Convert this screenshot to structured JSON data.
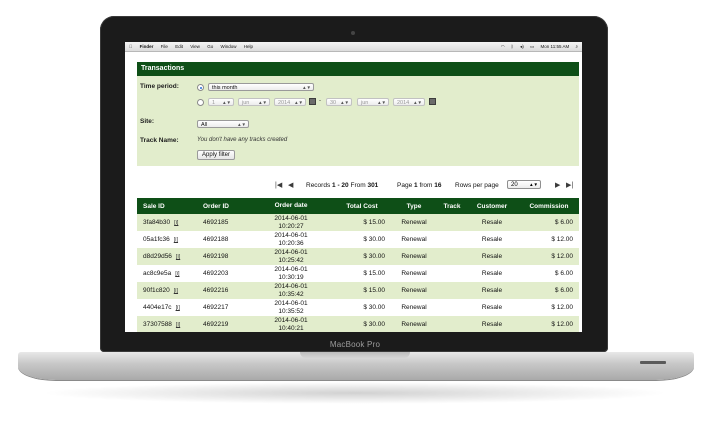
{
  "device": {
    "label": "MacBook Pro"
  },
  "menubar": {
    "items": [
      "Finder",
      "File",
      "Edit",
      "View",
      "Go",
      "Window",
      "Help"
    ],
    "clock": "Mon 11:55 AM"
  },
  "panel": {
    "title": "Transactions",
    "time_period_label": "Time period:",
    "period_value": "this month",
    "from_day": "1",
    "from_month": "jun",
    "from_year": "2014",
    "to_day": "30",
    "to_month": "jun",
    "to_year": "2014",
    "site_label": "Site:",
    "site_value": "All",
    "track_label": "Track Name:",
    "track_note": "You don't have any tracks created",
    "apply_label": "Apply filter"
  },
  "pager": {
    "records_label": "Records",
    "range": "1 - 20",
    "from_label": "From",
    "total": "301",
    "page_label": "Page",
    "page": "1",
    "page_from_label": "from",
    "pages": "16",
    "rows_label": "Rows per page",
    "rows_value": "20"
  },
  "table": {
    "columns": [
      "Sale ID",
      "Order ID",
      "Order date",
      "Total Cost",
      "Type",
      "Track",
      "Customer",
      "Commission"
    ],
    "rows": [
      {
        "sale_id": "3fa84b30",
        "order_id": "4692185",
        "date": "2014-06-01",
        "time": "10:20:27",
        "cost": "$ 15.00",
        "type": "Renewal",
        "track": "",
        "customer": "Resale",
        "commission": "$ 6.00"
      },
      {
        "sale_id": "05a1fc36",
        "order_id": "4692188",
        "date": "2014-06-01",
        "time": "10:20:36",
        "cost": "$ 30.00",
        "type": "Renewal",
        "track": "",
        "customer": "Resale",
        "commission": "$ 12.00"
      },
      {
        "sale_id": "d8d29d56",
        "order_id": "4692198",
        "date": "2014-06-01",
        "time": "10:25:42",
        "cost": "$ 30.00",
        "type": "Renewal",
        "track": "",
        "customer": "Resale",
        "commission": "$ 12.00"
      },
      {
        "sale_id": "ac8c9e5a",
        "order_id": "4692203",
        "date": "2014-06-01",
        "time": "10:30:19",
        "cost": "$ 15.00",
        "type": "Renewal",
        "track": "",
        "customer": "Resale",
        "commission": "$ 6.00"
      },
      {
        "sale_id": "90f1c820",
        "order_id": "4692216",
        "date": "2014-06-01",
        "time": "10:35:42",
        "cost": "$ 15.00",
        "type": "Renewal",
        "track": "",
        "customer": "Resale",
        "commission": "$ 6.00"
      },
      {
        "sale_id": "4404e17c",
        "order_id": "4692217",
        "date": "2014-06-01",
        "time": "10:35:52",
        "cost": "$ 30.00",
        "type": "Renewal",
        "track": "",
        "customer": "Resale",
        "commission": "$ 12.00"
      },
      {
        "sale_id": "37307588",
        "order_id": "4692219",
        "date": "2014-06-01",
        "time": "10:40:21",
        "cost": "$ 30.00",
        "type": "Renewal",
        "track": "",
        "customer": "Resale",
        "commission": "$ 12.00"
      }
    ]
  },
  "colors": {
    "header_green": "#0e4f17",
    "panel_bg": "#e2edcc",
    "row_alt": "#e2edcc"
  }
}
